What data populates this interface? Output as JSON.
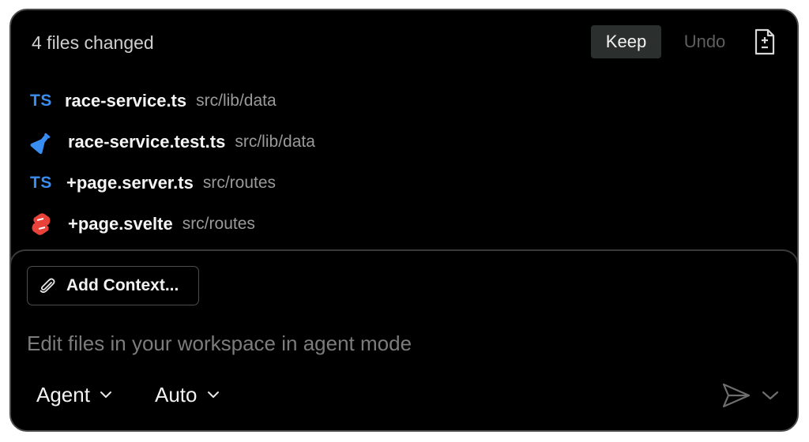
{
  "header": {
    "files_changed": "4 files changed",
    "keep_label": "Keep",
    "undo_label": "Undo",
    "diff_icon": "file-diff-icon"
  },
  "files": [
    {
      "icon": "typescript-icon",
      "icon_text": "TS",
      "name": "race-service.ts",
      "path": "src/lib/data"
    },
    {
      "icon": "test-flask-icon",
      "icon_text": "",
      "name": "race-service.test.ts",
      "path": "src/lib/data"
    },
    {
      "icon": "typescript-icon",
      "icon_text": "TS",
      "name": "+page.server.ts",
      "path": "src/routes"
    },
    {
      "icon": "svelte-icon",
      "icon_text": "",
      "name": "+page.svelte",
      "path": "src/routes"
    }
  ],
  "composer": {
    "add_context_label": "Add Context...",
    "placeholder": "Edit files in your workspace in agent mode",
    "mode_label": "Agent",
    "model_label": "Auto"
  },
  "colors": {
    "background": "#000000",
    "typescript": "#3a8df0",
    "svelte": "#e8423a",
    "keep_button": "#2b302f"
  }
}
